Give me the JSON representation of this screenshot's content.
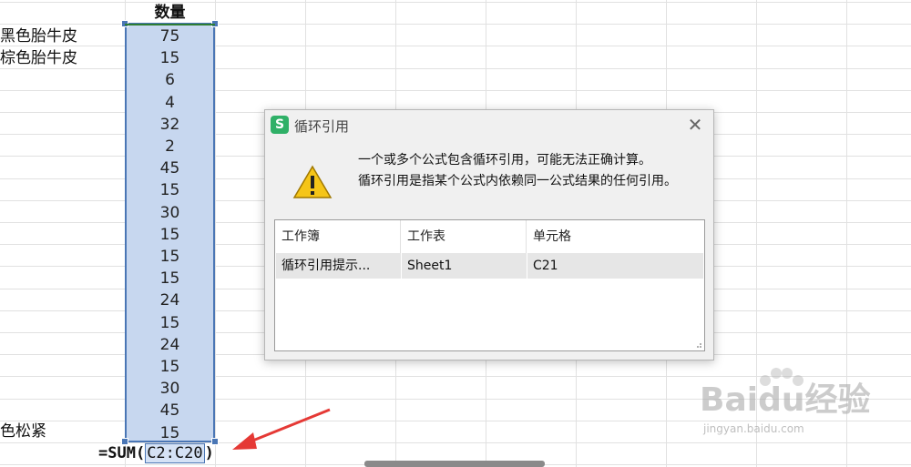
{
  "column_a": {
    "items": [
      "黑色胎牛皮",
      "棕色胎牛皮",
      "色松紧"
    ]
  },
  "column_c": {
    "header": "数量",
    "values": [
      "75",
      "15",
      "6",
      "4",
      "32",
      "2",
      "45",
      "15",
      "30",
      "15",
      "15",
      "15",
      "24",
      "15",
      "24",
      "15",
      "30",
      "45",
      "15"
    ]
  },
  "formula": {
    "prefix": "=SUM(",
    "range": "C2:C20",
    "suffix": ")"
  },
  "dialog": {
    "title": "循环引用",
    "app_icon_letter": "S",
    "close_symbol": "✕",
    "message_line1": "一个或多个公式包含循环引用，可能无法正确计算。",
    "message_line2": "循环引用是指某个公式内依赖同一公式结果的任何引用。",
    "table": {
      "headers": [
        "工作簿",
        "工作表",
        "单元格"
      ],
      "rows": [
        [
          "循环引用提示...",
          "Sheet1",
          "C21"
        ]
      ]
    }
  },
  "watermark": {
    "text": "Baidu经验",
    "url": "jingyan.baidu.com"
  },
  "colors": {
    "selection_fill": "#c7d7ef",
    "selection_border": "#4a76b5",
    "app_icon": "#2fb067",
    "arrow": "#e53935"
  }
}
